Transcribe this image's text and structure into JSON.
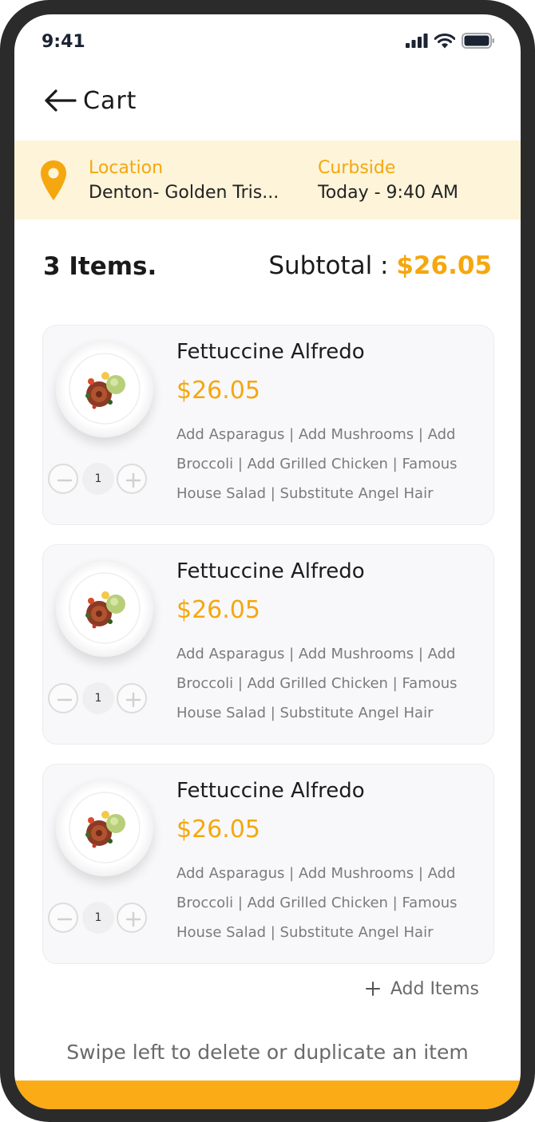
{
  "status_bar": {
    "time": "9:41"
  },
  "header": {
    "title": "Cart"
  },
  "banner": {
    "location_label": "Location",
    "location_value": "Denton- Golden Tris...",
    "pickup_label": "Curbside",
    "pickup_value": "Today - 9:40 AM"
  },
  "summary": {
    "items_count": "3 Items.",
    "subtotal_label": "Subtotal : ",
    "subtotal_amount": "$26.05"
  },
  "cart_items": [
    {
      "name": "Fettuccine Alfredo",
      "price": "$26.05",
      "modifiers": "Add Asparagus | Add Mushrooms | Add Broccoli | Add Grilled Chicken | Famous House Salad | Substitute Angel Hair",
      "quantity": "1"
    },
    {
      "name": "Fettuccine Alfredo",
      "price": "$26.05",
      "modifiers": "Add Asparagus | Add Mushrooms | Add Broccoli | Add Grilled Chicken | Famous House Salad | Substitute Angel Hair",
      "quantity": "1"
    },
    {
      "name": "Fettuccine Alfredo",
      "price": "$26.05",
      "modifiers": "Add Asparagus | Add Mushrooms | Add Broccoli | Add Grilled Chicken | Famous House Salad | Substitute Angel Hair",
      "quantity": "1"
    }
  ],
  "add_items_label": "Add Items",
  "hint": "Swipe left to delete or duplicate an item",
  "colors": {
    "accent": "#f5a70f",
    "banner_bg": "#fdf4d9",
    "bottom_bar": "#fbab16"
  },
  "icons": [
    "signal-icon",
    "wifi-icon",
    "battery-icon",
    "back-arrow-icon",
    "location-pin-icon",
    "minus-icon",
    "plus-icon"
  ]
}
